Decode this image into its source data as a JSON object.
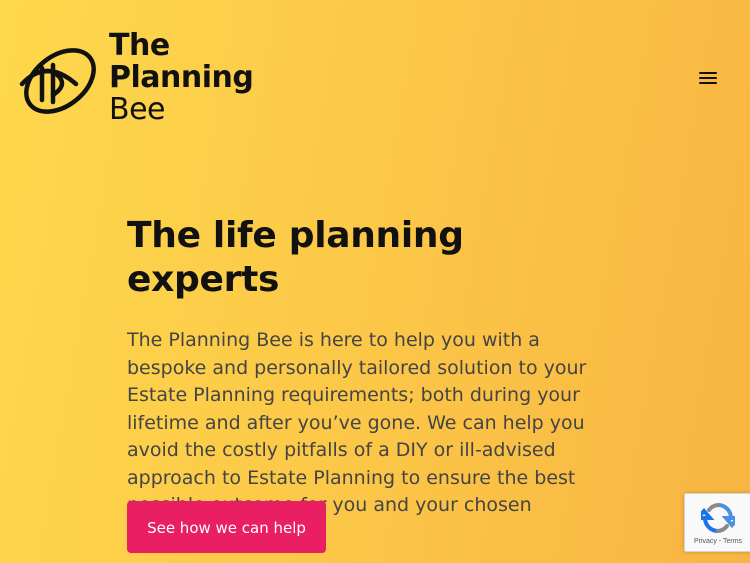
{
  "header": {
    "logo": {
      "line1": "The",
      "line2": "Planning",
      "line3": "Bee"
    },
    "menu_icon": "hamburger-menu-icon"
  },
  "hero": {
    "title": "The life planning experts",
    "body": "The Planning Bee is here to help you with a bespoke and personally tailored solution to your Estate Planning requirements; both during your lifetime and after you’ve gone. We can help you avoid the costly pitfalls of a DIY or ill-advised approach to Estate Planning to ensure the best possible outcome for you and your chosen beneficiaries.",
    "cta_label": "See how we can help"
  },
  "recaptcha": {
    "links": "Privacy - Terms",
    "icon": "recaptcha-icon"
  },
  "colors": {
    "background_start": "#fed84d",
    "background_end": "#f8b542",
    "accent": "#e91e63",
    "text_dark": "#111111",
    "text_body": "#444444"
  }
}
